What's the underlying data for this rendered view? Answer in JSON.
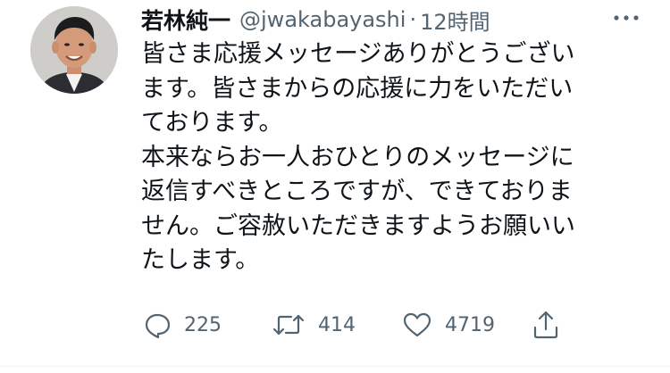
{
  "author": {
    "name": "若林純一",
    "handle": "@jwakabayashi",
    "separator": "·",
    "time": "12時間"
  },
  "tweet": {
    "lines": [
      "皆さま応援メッセージありがとうござい",
      "ます。皆さまからの応援に力をいただい",
      "ております。",
      "本来ならお一人おひとりのメッセージに",
      "返信すべきところですが、できておりま",
      "せん。ご容赦いただきますようお願いい",
      "たします。"
    ]
  },
  "actions": {
    "reply": {
      "icon": "reply-icon",
      "count": "225"
    },
    "retweet": {
      "icon": "retweet-icon",
      "count": "414"
    },
    "like": {
      "icon": "heart-icon",
      "count": "4719"
    },
    "share": {
      "icon": "share-icon"
    }
  },
  "colors": {
    "text_primary": "#0f1419",
    "text_secondary": "#536471"
  }
}
